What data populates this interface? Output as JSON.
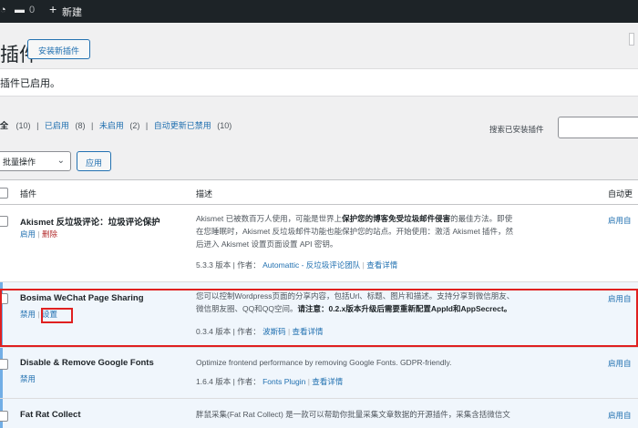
{
  "adminbar": {
    "comments_count": "0",
    "new_label": "新建"
  },
  "page": {
    "title": "插件",
    "add_new_label": "安装新插件"
  },
  "notice": {
    "text": "插件已启用。"
  },
  "filters": {
    "all": "(10)",
    "active_label": "已启用",
    "active_count": "(8)",
    "inactive_label": "未启用",
    "inactive_count": "(2)",
    "autoupdate_label": "自动更新已禁用",
    "autoupdate_count": "(10)"
  },
  "search": {
    "label": "搜索已安装插件"
  },
  "bulk": {
    "select_label": "批量操作",
    "apply_label": "应用"
  },
  "table": {
    "col_plugin": "插件",
    "col_description": "描述",
    "col_autoupdate": "自动更",
    "rows": [
      {
        "name": "Akismet 反垃圾评论：垃圾评论保护",
        "link1": "启用",
        "link2": "删除",
        "desc1": "Akismet 已被数百万人使用，可能是世界上",
        "desc1_bold": "保护您的博客免受垃圾邮件侵害",
        "desc1_end": "的最佳方法。即使",
        "desc2": "在您睡眠时，Akismet 反垃圾邮件功能也能保护您的站点。开始使用：激活 Akismet 插件，然",
        "desc3": "后进入 Akismet 设置页面设置 API 密钥。",
        "version": "5.3.3 版本 | 作者：",
        "author": "Automattic - 反垃圾评论团队",
        "details": "查看详情",
        "autoupdate": "启用自"
      },
      {
        "name": "Bosima WeChat Page Sharing",
        "link1": "禁用",
        "link2": "设置",
        "desc1": "您可以控制Wordpress页面的分享内容，包括Url、标题、图片和描述。支持分享到微信朋友、",
        "desc2": "微信朋友圈、QQ和QQ空间。",
        "desc2_bold1": "请注意：",
        "desc2_bold2": "0.2.x版本升级后需要重新配置AppId和AppSecrect。",
        "version": "0.3.4 版本 | 作者：",
        "author": "波斯码",
        "details": "查看详情",
        "autoupdate": "启用自"
      },
      {
        "name": "Disable & Remove Google Fonts",
        "link1": "禁用",
        "desc1": "Optimize frontend performance by removing Google Fonts. GDPR-friendly.",
        "version": "1.6.4 版本 | 作者：",
        "author": "Fonts Plugin",
        "details": "查看详情",
        "autoupdate": "启用自"
      },
      {
        "name": "Fat Rat Collect",
        "desc1": "胖鼠采集(Fat Rat Collect) 是一款可以帮助你批量采集文章数据的开源插件，采集含括微信文",
        "autoupdate": "启用自"
      }
    ]
  }
}
